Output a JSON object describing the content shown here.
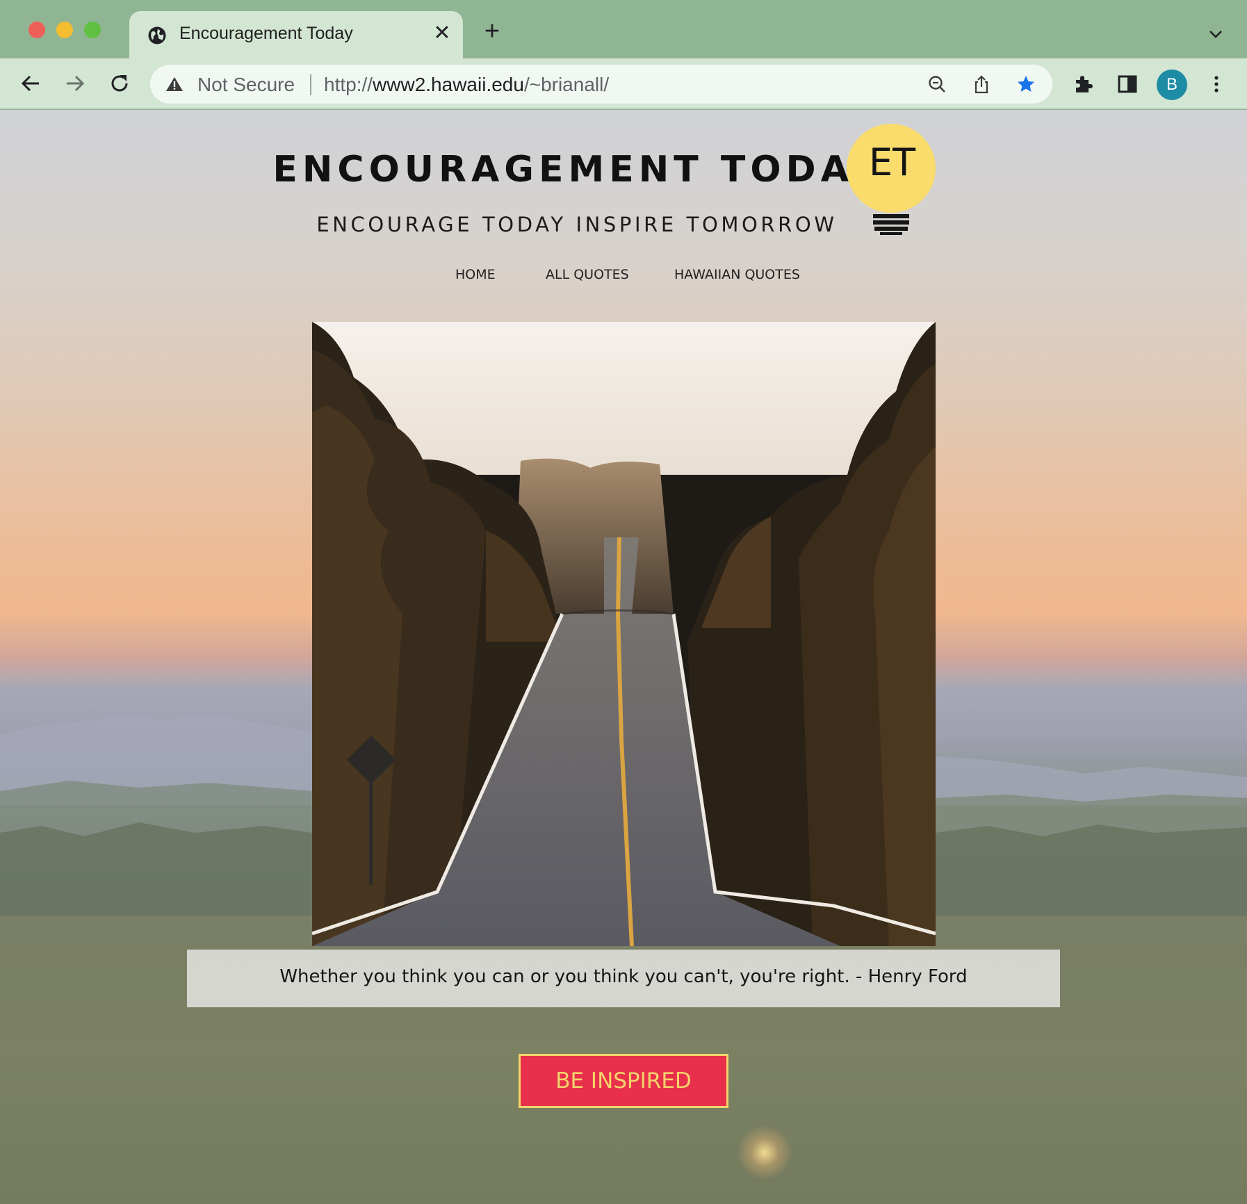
{
  "browser": {
    "tab": {
      "title": "Encouragement Today",
      "favicon": "globe-icon",
      "close": "✕"
    },
    "new_tab": "+",
    "omnibox": {
      "security_label": "Not Secure",
      "url_scheme": "http://",
      "url_host": "www2.hawaii.edu",
      "url_path": "/~brianall/"
    },
    "profile_initial": "B",
    "accent_star_color": "#1a73e8"
  },
  "site": {
    "title": "ENCOURAGEMENT TODAY",
    "tagline": "ENCOURAGE TODAY INSPIRE TOMORROW",
    "logo_text": "ET",
    "nav": [
      {
        "label": "HOME"
      },
      {
        "label": "ALL QUOTES"
      },
      {
        "label": "HAWAIIAN QUOTES"
      }
    ],
    "quote": "Whether you think you can or you think you can't, you're right. - Henry Ford",
    "cta_label": "BE INSPIRED",
    "colors": {
      "cta_bg": "#e8304c",
      "cta_text": "#f3d36b",
      "logo": "#f9dc6b"
    }
  }
}
